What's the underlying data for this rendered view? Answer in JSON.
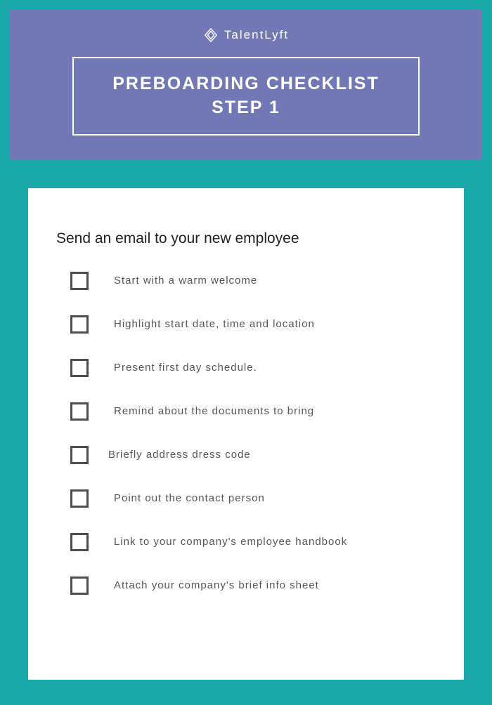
{
  "logo": {
    "brand_text": "TalentLyft"
  },
  "heading": {
    "line1": "PREBOARDING CHECKLIST",
    "line2": "STEP 1"
  },
  "section_title": "Send an email to your new employee",
  "checklist": [
    {
      "label": "Start with a warm welcome"
    },
    {
      "label": "Highlight start date, time and location"
    },
    {
      "label": "Present first day schedule."
    },
    {
      "label": "Remind about the documents to bring"
    },
    {
      "label": "Briefly address dress code"
    },
    {
      "label": "Point out the contact person"
    },
    {
      "label": "Link to your company's employee handbook"
    },
    {
      "label": "Attach your company's brief info sheet"
    }
  ]
}
